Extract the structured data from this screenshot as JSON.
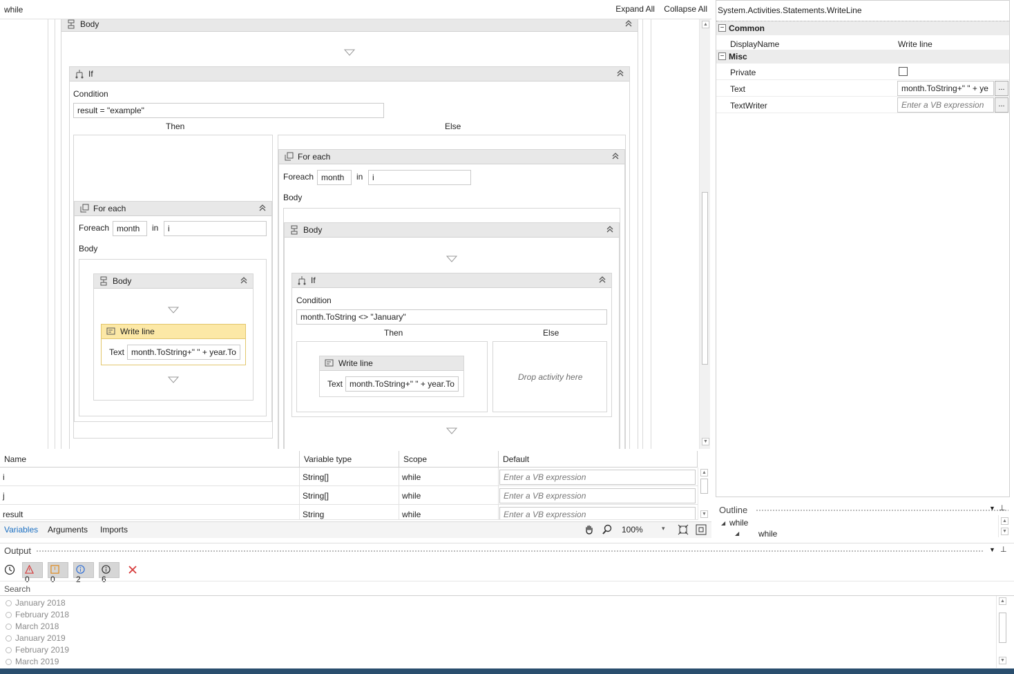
{
  "designer": {
    "breadcrumb": "while",
    "expand_all": "Expand All",
    "collapse_all": "Collapse All"
  },
  "canvas": {
    "outer_body_title": "Body",
    "if_title": "If",
    "condition_label": "Condition",
    "condition_value": "result = \"example\"",
    "then_label": "Then",
    "else_label": "Else",
    "then_branch": {
      "foreach_title": "For each",
      "foreach_label": "Foreach",
      "foreach_var": "month",
      "in_label": "in",
      "in_value": "i",
      "body_label": "Body",
      "body_title": "Body",
      "writeline_title": "Write line",
      "text_label": "Text",
      "text_value": "month.ToString+\" \" + year.To"
    },
    "else_branch": {
      "foreach_title": "For each",
      "foreach_label": "Foreach",
      "foreach_var": "month",
      "in_label": "in",
      "in_value": "i",
      "body_label": "Body",
      "body_title": "Body",
      "if_title": "If",
      "condition_label": "Condition",
      "condition_value": "month.ToString <> \"January\"",
      "then_label": "Then",
      "else_label": "Else",
      "writeline_title": "Write line",
      "text_label": "Text",
      "text_value": "month.ToString+\" \" + year.To",
      "drop_hint": "Drop activity here"
    }
  },
  "variables": {
    "columns": [
      "Name",
      "Variable type",
      "Scope",
      "Default"
    ],
    "rows": [
      {
        "name": "i",
        "type": "String[]",
        "scope": "while",
        "default_placeholder": "Enter a VB expression"
      },
      {
        "name": "j",
        "type": "String[]",
        "scope": "while",
        "default_placeholder": "Enter a VB expression"
      },
      {
        "name": "result",
        "type": "String",
        "scope": "while",
        "default_placeholder": "Enter a VB expression"
      }
    ],
    "tabs": [
      "Variables",
      "Arguments",
      "Imports"
    ],
    "zoom": "100%"
  },
  "properties": {
    "title": "System.Activities.Statements.WriteLine",
    "categories": [
      {
        "name": "Common",
        "rows": [
          {
            "name": "DisplayName",
            "value": "Write line"
          }
        ]
      },
      {
        "name": "Misc",
        "rows": [
          {
            "name": "Private",
            "value": ""
          },
          {
            "name": "Text",
            "value": "month.ToString+\" \" + ye"
          },
          {
            "name": "TextWriter",
            "placeholder": "Enter a VB expression"
          }
        ]
      }
    ],
    "ellipsis": "..."
  },
  "outline": {
    "title": "Outline",
    "root": "while",
    "child": "while"
  },
  "output": {
    "title": "Output",
    "counts": {
      "errors": "0",
      "warnings": "0",
      "info": "2",
      "trace": "6"
    },
    "search_placeholder": "Search",
    "lines": [
      "January 2018",
      "February 2018",
      "March 2018",
      "January 2019",
      "February 2019",
      "March 2019"
    ]
  }
}
